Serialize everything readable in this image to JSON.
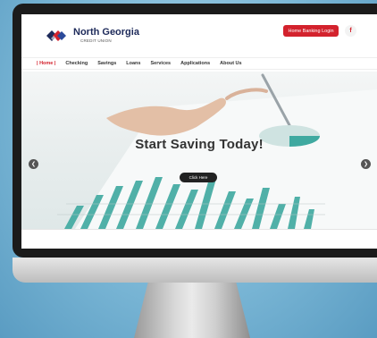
{
  "brand": {
    "name": "North Georgia",
    "subtitle": "CREDIT UNION"
  },
  "header": {
    "login_label": "Home Banking Login",
    "facebook_label": "f"
  },
  "nav": {
    "items": [
      {
        "label": "| Home |",
        "active": true
      },
      {
        "label": "Checking",
        "active": false
      },
      {
        "label": "Savings",
        "active": false
      },
      {
        "label": "Loans",
        "active": false
      },
      {
        "label": "Services",
        "active": false
      },
      {
        "label": "Applications",
        "active": false
      },
      {
        "label": "About Us",
        "active": false
      }
    ]
  },
  "hero": {
    "title": "Start Saving Today!",
    "button_label": "Click Here",
    "prev_icon": "chevron-left-icon",
    "next_icon": "chevron-right-icon"
  },
  "colors": {
    "accent": "#d3222d",
    "brand_navy": "#1d2a5a",
    "teal_chart": "#3fa9a0"
  }
}
